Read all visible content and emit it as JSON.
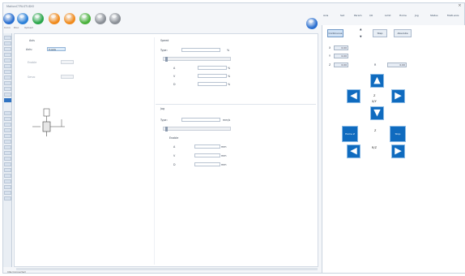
{
  "window": {
    "title": "MotionCTRLSTUDIO",
    "close_glyph": "×"
  },
  "toolbar": {
    "icons": [
      {
        "name": "connect-icon",
        "color": "#2a6fd0"
      },
      {
        "name": "refresh-icon",
        "color": "#2a80d8"
      },
      {
        "name": "run-icon",
        "color": "#2aa64a"
      },
      {
        "name": "orange-icon-1",
        "color": "#f08a1c"
      },
      {
        "name": "orange-icon-2",
        "color": "#f08a1c"
      },
      {
        "name": "green-icon",
        "color": "#49b13b"
      },
      {
        "name": "gray-icon-1",
        "color": "#8a8f96"
      },
      {
        "name": "gray-icon-2",
        "color": "#8a8f96"
      }
    ],
    "labels": [
      "Conn",
      "Disc",
      "Upload"
    ],
    "help_icon_color": "#2a6fd0"
  },
  "right_toolbar": [
    "Axis",
    "Set",
    "Param",
    "I/O",
    "Limit",
    "Home",
    "Jog",
    "Status",
    "Multi-axis"
  ],
  "status_bar": {
    "text": "Idle   Connected"
  },
  "main_left": {
    "section_title": "Axis",
    "axis_label": "Axis:",
    "axis_value": "X-axis",
    "row2_label": "Enable",
    "row3_label": "Servo"
  },
  "main_right_top": {
    "title": "Speed",
    "label1": "Type:",
    "unit": "%",
    "rows": [
      {
        "label": "A",
        "unit": "%"
      },
      {
        "label": "V",
        "unit": "%"
      },
      {
        "label": "D",
        "unit": "%"
      }
    ]
  },
  "main_right_bottom": {
    "title": "Jog",
    "label1": "Type:",
    "unit": "mm/s",
    "checkbox_label": "Enable",
    "rows": [
      {
        "label": "A",
        "unit": "mm"
      },
      {
        "label": "V",
        "unit": "mm"
      },
      {
        "label": "D",
        "unit": "mm"
      }
    ]
  },
  "right_panel": {
    "buttons": [
      "Continuous",
      "Step",
      "Absolute"
    ],
    "spinner_up": "▲",
    "spinner_down": "▼",
    "fields": [
      {
        "label": "X",
        "value": "0.00"
      },
      {
        "label": "Y",
        "value": "0.00"
      },
      {
        "label": "Z",
        "value": "0.00",
        "extra_label": "R",
        "extra_value": "0.00"
      }
    ],
    "arrows": {
      "up": "▲",
      "down": "▼",
      "left": "◀",
      "right": "▶",
      "left2": "◀",
      "right2": "▶"
    },
    "center_text_1": "Z",
    "center_text_2": "X/Y",
    "center_text_3": "Z",
    "center_text_4": "R/Z",
    "wide_left": "Home Z",
    "wide_right": "Stop"
  }
}
